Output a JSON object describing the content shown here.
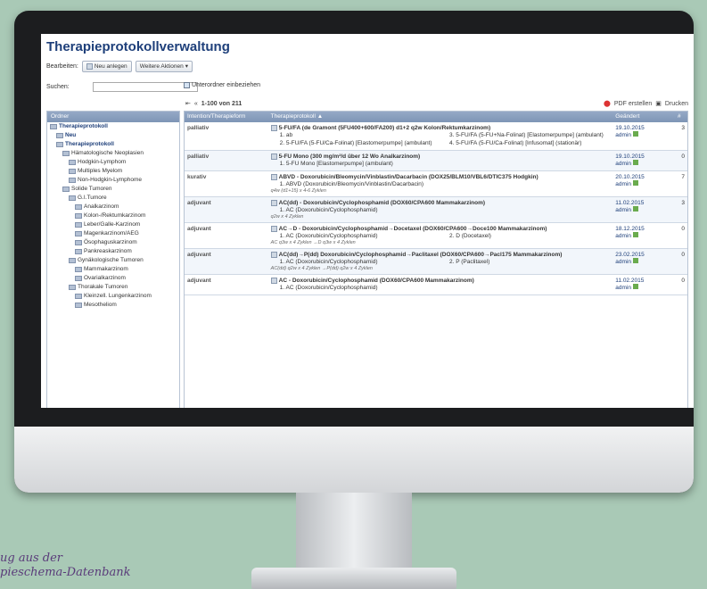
{
  "app": {
    "title": "Therapieprotokollverwaltung"
  },
  "toolbar": {
    "edit_label": "Bearbeiten:",
    "new_label": "Neu anlegen",
    "more_label": "Weitere Aktionen"
  },
  "search": {
    "label": "Suchen:",
    "placeholder": "",
    "subfolders_label": "Unterordner einbeziehen"
  },
  "pager": {
    "range": "1-100 von 211",
    "pdf": "PDF erstellen",
    "print": "Drucken"
  },
  "folders": {
    "header": "Ordner",
    "items": [
      {
        "label": "Therapieprotokoll",
        "level": 0,
        "bold": true
      },
      {
        "label": "Neu",
        "level": 1,
        "bold": true
      },
      {
        "label": "Therapieprotokoll",
        "level": 1,
        "bold": true
      },
      {
        "label": "Hämatologische Neoplasien",
        "level": 2
      },
      {
        "label": "Hodgkin-Lymphom",
        "level": 3
      },
      {
        "label": "Multiples Myelom",
        "level": 3
      },
      {
        "label": "Non-Hodgkin-Lymphome",
        "level": 3
      },
      {
        "label": "Solide Tumoren",
        "level": 2
      },
      {
        "label": "G.I.Tumore",
        "level": 3
      },
      {
        "label": "Analkarzinom",
        "level": 4
      },
      {
        "label": "Kolon-/Rektumkarzinom",
        "level": 4
      },
      {
        "label": "Leber/Galle-Karzinom",
        "level": 4
      },
      {
        "label": "Magenkarzinom/AEG",
        "level": 4
      },
      {
        "label": "Ösophaguskarzinom",
        "level": 4
      },
      {
        "label": "Pankreaskarzinom",
        "level": 4
      },
      {
        "label": "Gynäkologische Tumoren",
        "level": 3
      },
      {
        "label": "Mammakarzinom",
        "level": 4
      },
      {
        "label": "Ovarialkarzinom",
        "level": 4
      },
      {
        "label": "Thorakale Tumoren",
        "level": 3
      },
      {
        "label": "Kleinzell. Lungenkarzinom",
        "level": 4
      },
      {
        "label": "Mesotheliom",
        "level": 4
      }
    ]
  },
  "grid": {
    "columns": [
      "Intention/Therapieform",
      "Therapieprotokoll ▲",
      "Geändert",
      "#"
    ],
    "rows": [
      {
        "intent": "palliativ",
        "protocol": "5-FU/FA (de Gramont (5FU400+600/FA200) d1+2 q2w Kolon/Rektumkarzinom)",
        "items": [
          "1. ab",
          "3. 5-FU/FA (5-FU+Na-Folinat) [Elastomerpumpe] (ambulant)",
          "2. 5-FU/FA (5-FU/Ca-Folinat) [Elastomerpumpe] (ambulant)",
          "4. 5-FU/FA (5-FU/Ca-Folinat) [Infusomat] (stationär)"
        ],
        "schedule": "",
        "date": "19.10.2015",
        "user": "admin",
        "count": "3"
      },
      {
        "intent": "palliativ",
        "protocol": "5-FU Mono (300 mg/m²/d über 12 Wo Analkarzinom)",
        "items": [
          "1. 5-FU Mono [Elastomerpumpe] (ambulant)"
        ],
        "schedule": "",
        "date": "19.10.2015",
        "user": "admin",
        "count": "0"
      },
      {
        "intent": "kurativ",
        "protocol": "ABVD - Doxorubicin/Bleomycin/Vinblastin/Dacarbacin (DOX25/BLM10/VBL6/DTIC375 Hodgkin)",
        "items": [
          "1. ABVD (Doxorubicin/Bleomycin/Vinblastin/Dacarbacin)"
        ],
        "schedule": "q4w (d1+15) x 4-6 Zyklen",
        "date": "20.10.2015",
        "user": "admin",
        "count": "7"
      },
      {
        "intent": "adjuvant",
        "protocol": "AC(dd) - Doxorubicin/Cyclophosphamid (DOX60/CPA600 Mammakarzinom)",
        "items": [
          "1. AC (Doxorubicin/Cyclophosphamid)"
        ],
        "schedule": "q2w x 4 Zyklen",
        "date": "11.02.2015",
        "user": "admin",
        "count": "3"
      },
      {
        "intent": "adjuvant",
        "protocol": "AC→D - Doxorubicin/Cyclophosphamid→Docetaxel (DOX60/CPA600→Doce100 Mammakarzinom)",
        "items": [
          "1. AC (Doxorubicin/Cyclophosphamid)",
          "2. D (Docetaxel)"
        ],
        "schedule": "AC q3w x 4 Zyklen →D q3w x 4 Zyklen",
        "date": "18.12.2015",
        "user": "admin",
        "count": "0"
      },
      {
        "intent": "adjuvant",
        "protocol": "AC(dd)→P(dd) Doxorubicin/Cyclophosphamid→Paclitaxel (DOX60/CPA600→Pacl175 Mammakarzinom)",
        "items": [
          "1. AC (Doxorubicin/Cyclophosphamid)",
          "2. P (Paclitaxel)"
        ],
        "schedule": "AC(dd) q2w x 4 Zyklen →P(dd) q2w x 4 Zyklen",
        "date": "23.02.2015",
        "user": "admin",
        "count": "0"
      },
      {
        "intent": "adjuvant",
        "protocol": "AC - Doxorubicin/Cyclophosphamid (DOX60/CPA600 Mammakarzinom)",
        "items": [
          "1. AC (Doxorubicin/Cyclophosphamid)"
        ],
        "schedule": "",
        "date": "11.02.2015",
        "user": "admin",
        "count": "0"
      }
    ]
  },
  "caption": {
    "line1": "ug aus  der",
    "line2": "pieschema-Datenbank"
  },
  "colors": {
    "title": "#1e3f7a",
    "header": "#7e95b6",
    "background": "#a9c9b6"
  }
}
